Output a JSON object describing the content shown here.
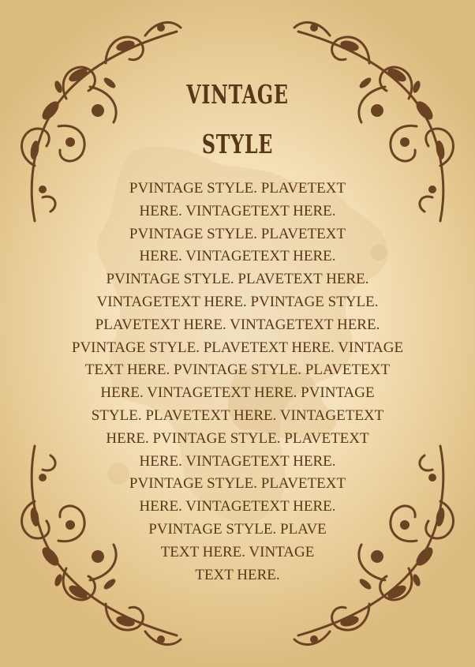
{
  "colors": {
    "background_center": "#fdf3df",
    "background_edge": "#dcbb80",
    "ink": "#5a3618",
    "stain": "#e4c99a"
  },
  "title": {
    "line1": "VINTAGE",
    "line2": "STYLE"
  },
  "body_lines": [
    "PVINTAGE STYLE. PLAVETEXT",
    "HERE. VINTAGETEXT HERE.",
    "PVINTAGE STYLE. PLAVETEXT",
    "HERE. VINTAGETEXT HERE.",
    "PVINTAGE STYLE. PLAVETEXT HERE.",
    "VINTAGETEXT HERE. PVINTAGE STYLE.",
    "PLAVETEXT HERE. VINTAGETEXT HERE.",
    "PVINTAGE STYLE. PLAVETEXT HERE. VINTAGE",
    "TEXT HERE. PVINTAGE STYLE. PLAVETEXT",
    "HERE. VINTAGETEXT HERE. PVINTAGE",
    "STYLE. PLAVETEXT HERE. VINTAGETEXT",
    "HERE. PVINTAGE STYLE. PLAVETEXT",
    "HERE. VINTAGETEXT HERE.",
    "PVINTAGE STYLE. PLAVETEXT",
    "HERE. VINTAGETEXT HERE.",
    "PVINTAGE STYLE. PLAVE",
    "TEXT HERE. VINTAGE",
    "TEXT HERE."
  ],
  "icons": {
    "corners": "floral-corner-ornament-icon",
    "stain": "grunge-stain-icon"
  }
}
